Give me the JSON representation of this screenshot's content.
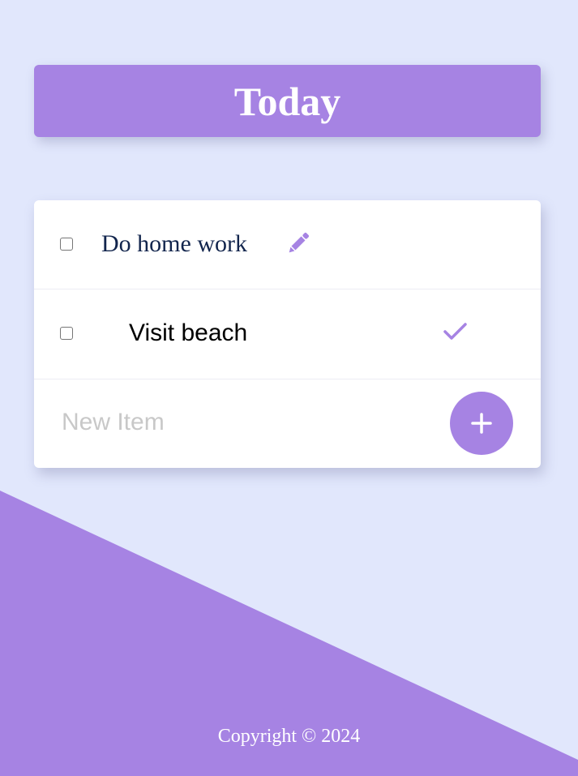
{
  "header": {
    "title": "Today"
  },
  "todo_list": {
    "items": [
      {
        "text": "Do home work",
        "checked": false,
        "editing": true,
        "action_icon": "pencil-icon"
      },
      {
        "text": "Visit beach",
        "checked": false,
        "editing": false,
        "action_icon": "check-icon"
      }
    ],
    "new_item": {
      "placeholder": "New Item",
      "value": ""
    },
    "add_button_icon": "plus-icon"
  },
  "footer": {
    "copyright": "Copyright © 2024"
  },
  "colors": {
    "background": "#e1e7fc",
    "accent": "#a683e3",
    "card": "#ffffff",
    "edit_text": "#12254d"
  }
}
